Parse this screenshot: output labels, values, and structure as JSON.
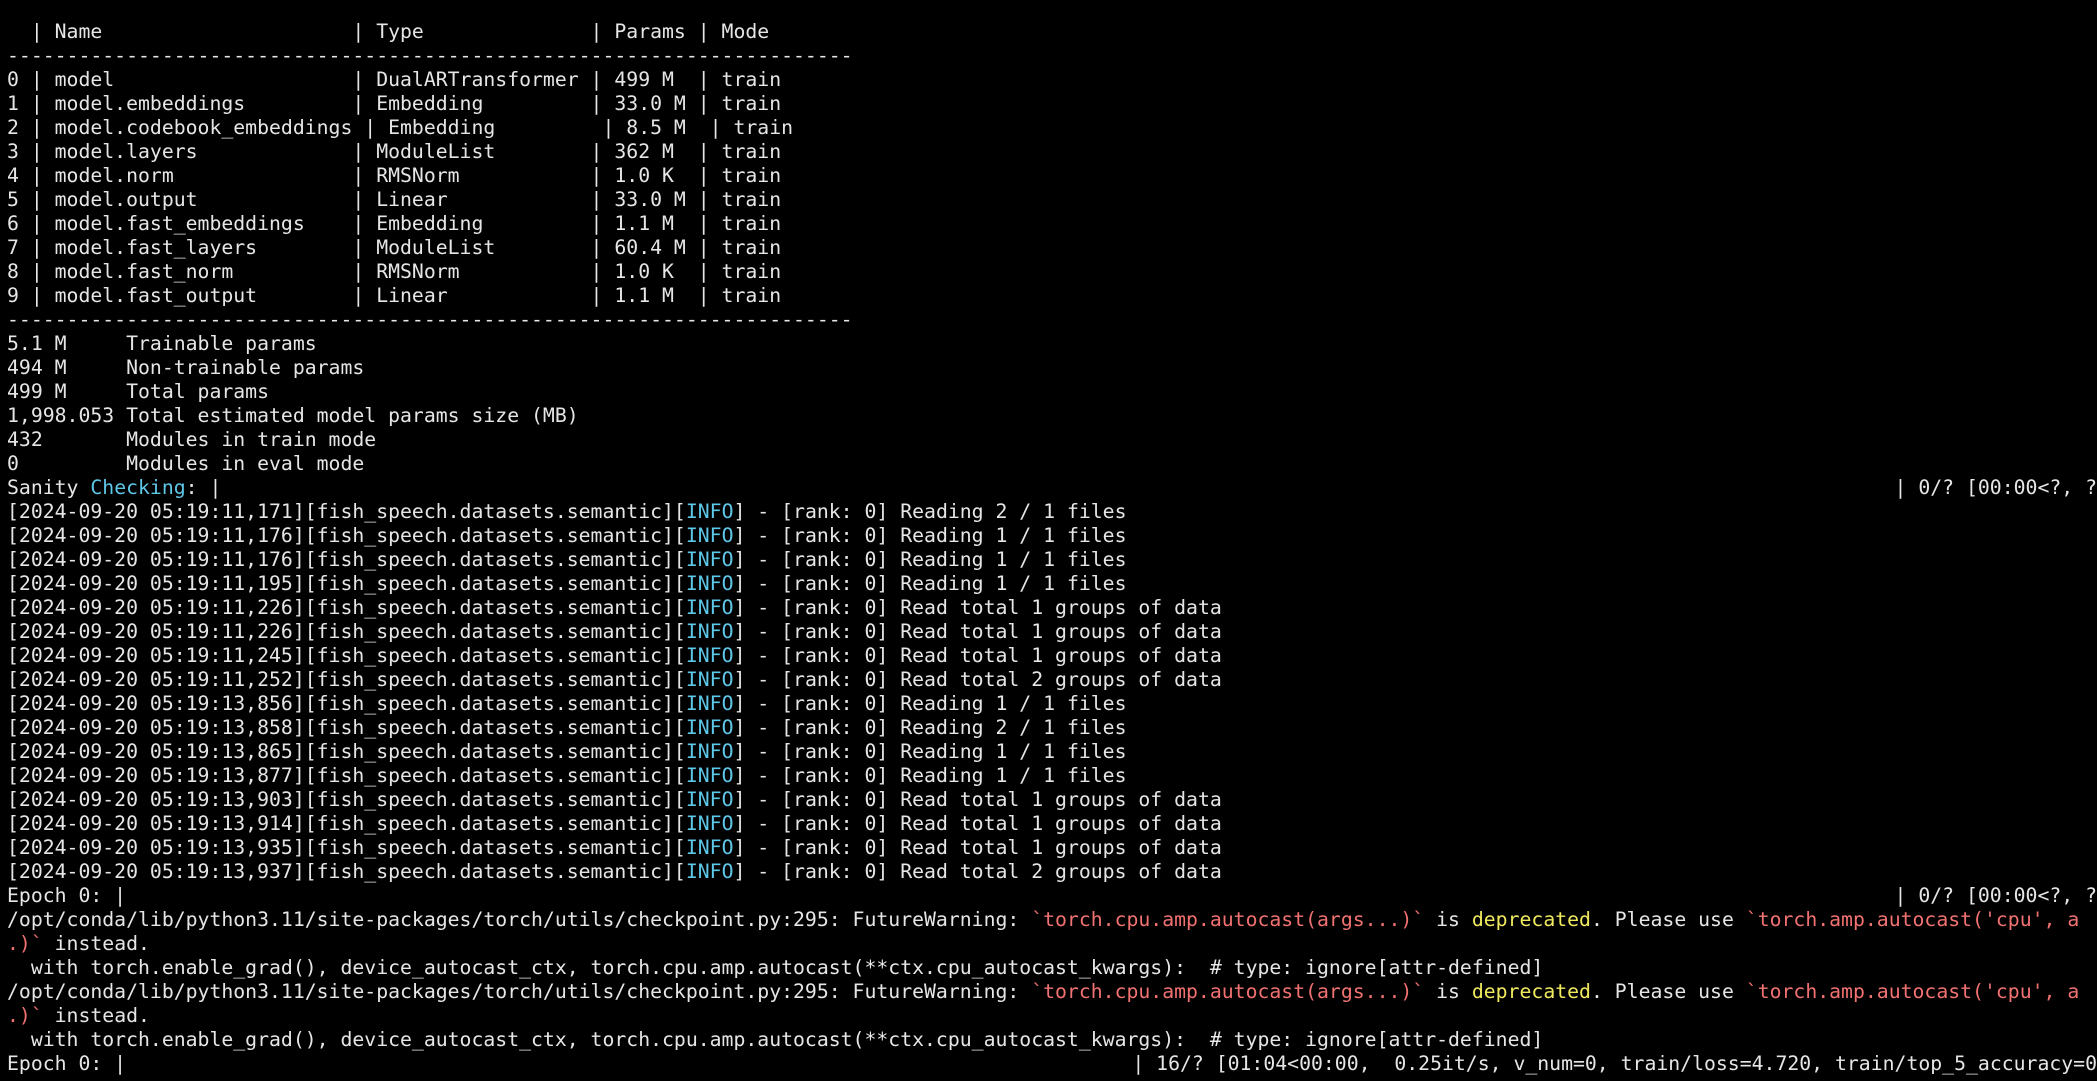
{
  "table": {
    "header": "  | Name                     | Type              | Params | Mode",
    "separator": "-----------------------------------------------------------------------",
    "rows": [
      "0 | model                    | DualARTransformer | 499 M  | train",
      "1 | model.embeddings         | Embedding         | 33.0 M | train",
      "2 | model.codebook_embeddings | Embedding         | 8.5 M  | train",
      "3 | model.layers             | ModuleList        | 362 M  | train",
      "4 | model.norm               | RMSNorm           | 1.0 K  | train",
      "5 | model.output             | Linear            | 33.0 M | train",
      "6 | model.fast_embeddings    | Embedding         | 1.1 M  | train",
      "7 | model.fast_layers        | ModuleList        | 60.4 M | train",
      "8 | model.fast_norm          | RMSNorm           | 1.0 K  | train",
      "9 | model.fast_output        | Linear            | 1.1 M  | train"
    ]
  },
  "summary": [
    "5.1 M     Trainable params",
    "494 M     Non-trainable params",
    "499 M     Total params",
    "1,998.053 Total estimated model params size (MB)",
    "432       Modules in train mode",
    "0         Modules in eval mode"
  ],
  "sanity": {
    "prefix": "Sanity ",
    "word": "Checking",
    "suffix": ": |",
    "right": "| 0/? [00:00<?, ?"
  },
  "logs": [
    {
      "ts": "[2024-09-20 05:19:11,171][fish_speech.datasets.semantic][",
      "lvl": "INFO",
      "msg": "] - [rank: 0] Reading 2 / 1 files"
    },
    {
      "ts": "[2024-09-20 05:19:11,176][fish_speech.datasets.semantic][",
      "lvl": "INFO",
      "msg": "] - [rank: 0] Reading 1 / 1 files"
    },
    {
      "ts": "[2024-09-20 05:19:11,176][fish_speech.datasets.semantic][",
      "lvl": "INFO",
      "msg": "] - [rank: 0] Reading 1 / 1 files"
    },
    {
      "ts": "[2024-09-20 05:19:11,195][fish_speech.datasets.semantic][",
      "lvl": "INFO",
      "msg": "] - [rank: 0] Reading 1 / 1 files"
    },
    {
      "ts": "[2024-09-20 05:19:11,226][fish_speech.datasets.semantic][",
      "lvl": "INFO",
      "msg": "] - [rank: 0] Read total 1 groups of data"
    },
    {
      "ts": "[2024-09-20 05:19:11,226][fish_speech.datasets.semantic][",
      "lvl": "INFO",
      "msg": "] - [rank: 0] Read total 1 groups of data"
    },
    {
      "ts": "[2024-09-20 05:19:11,245][fish_speech.datasets.semantic][",
      "lvl": "INFO",
      "msg": "] - [rank: 0] Read total 1 groups of data"
    },
    {
      "ts": "[2024-09-20 05:19:11,252][fish_speech.datasets.semantic][",
      "lvl": "INFO",
      "msg": "] - [rank: 0] Read total 2 groups of data"
    },
    {
      "ts": "[2024-09-20 05:19:13,856][fish_speech.datasets.semantic][",
      "lvl": "INFO",
      "msg": "] - [rank: 0] Reading 1 / 1 files"
    },
    {
      "ts": "[2024-09-20 05:19:13,858][fish_speech.datasets.semantic][",
      "lvl": "INFO",
      "msg": "] - [rank: 0] Reading 2 / 1 files"
    },
    {
      "ts": "[2024-09-20 05:19:13,865][fish_speech.datasets.semantic][",
      "lvl": "INFO",
      "msg": "] - [rank: 0] Reading 1 / 1 files"
    },
    {
      "ts": "[2024-09-20 05:19:13,877][fish_speech.datasets.semantic][",
      "lvl": "INFO",
      "msg": "] - [rank: 0] Reading 1 / 1 files"
    },
    {
      "ts": "[2024-09-20 05:19:13,903][fish_speech.datasets.semantic][",
      "lvl": "INFO",
      "msg": "] - [rank: 0] Read total 1 groups of data"
    },
    {
      "ts": "[2024-09-20 05:19:13,914][fish_speech.datasets.semantic][",
      "lvl": "INFO",
      "msg": "] - [rank: 0] Read total 1 groups of data"
    },
    {
      "ts": "[2024-09-20 05:19:13,935][fish_speech.datasets.semantic][",
      "lvl": "INFO",
      "msg": "] - [rank: 0] Read total 1 groups of data"
    },
    {
      "ts": "[2024-09-20 05:19:13,937][fish_speech.datasets.semantic][",
      "lvl": "INFO",
      "msg": "] - [rank: 0] Read total 2 groups of data"
    }
  ],
  "epoch1": {
    "left": "Epoch 0: |",
    "right": "| 0/? [00:00<?, ?"
  },
  "warnings": [
    {
      "path": "/opt/conda/lib/python3.11/site-packages/torch/utils/checkpoint.py:295: FutureWarning: ",
      "code1": "`torch.cpu.amp.autocast(args...)`",
      "mid1": " is ",
      "dep": "deprecated",
      "mid2": ". Please use ",
      "code2": "`torch.amp.autocast('cpu', a",
      "wrap_code": ".)`",
      "wrap_text": " instead.",
      "with_line": "  with torch.enable_grad(), device_autocast_ctx, torch.cpu.amp.autocast(**ctx.cpu_autocast_kwargs):  # type: ignore[attr-defined]"
    },
    {
      "path": "/opt/conda/lib/python3.11/site-packages/torch/utils/checkpoint.py:295: FutureWarning: ",
      "code1": "`torch.cpu.amp.autocast(args...)`",
      "mid1": " is ",
      "dep": "deprecated",
      "mid2": ". Please use ",
      "code2": "`torch.amp.autocast('cpu', a",
      "wrap_code": ".)`",
      "wrap_text": " instead.",
      "with_line": "  with torch.enable_grad(), device_autocast_ctx, torch.cpu.amp.autocast(**ctx.cpu_autocast_kwargs):  # type: ignore[attr-defined]"
    }
  ],
  "epoch2": {
    "left": "Epoch 0: |",
    "right": "| 16/? [01:04<00:00,  0.25it/s, v_num=0, train/loss=4.720, train/top_5_accuracy=0"
  },
  "colors": {
    "background": "#000000",
    "foreground": "#e6e6e6",
    "info": "#5ec8e8",
    "code": "#f27272",
    "deprecated": "#f0ea5e"
  }
}
